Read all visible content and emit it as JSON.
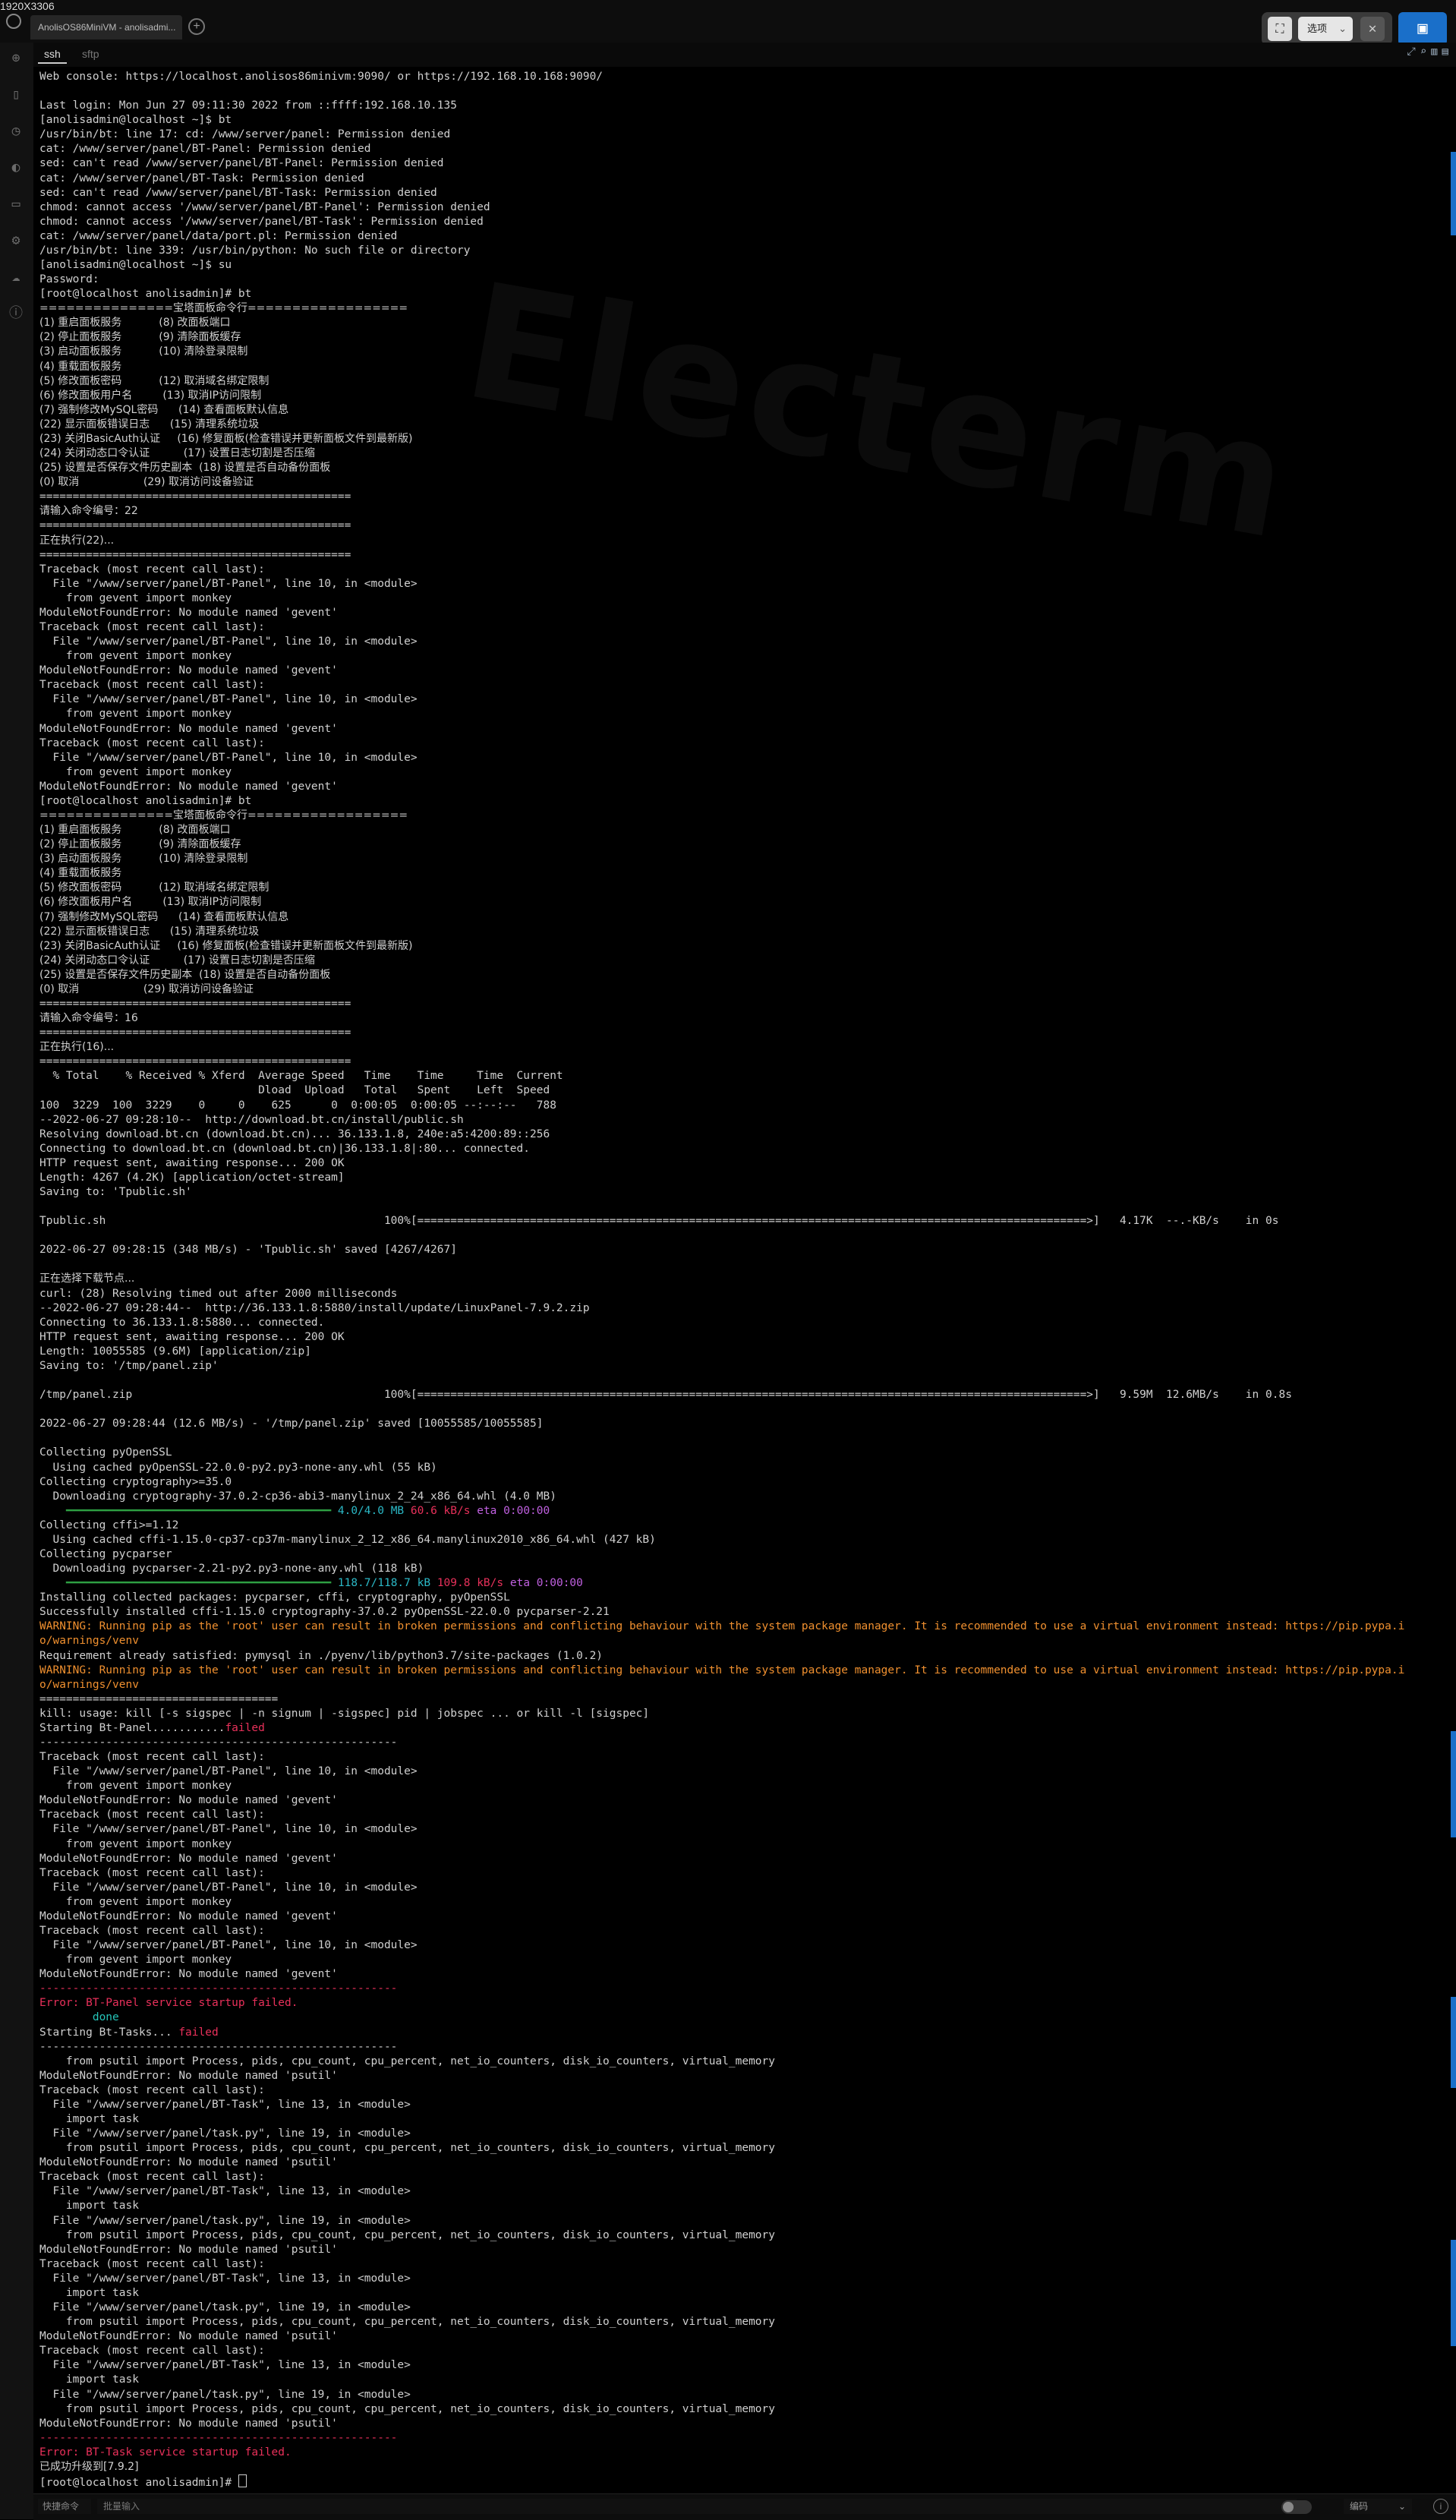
{
  "window": {
    "dimension_label": "1920X3306",
    "tab_title": "AnolisOS86MiniVM - anolisadmi...",
    "tab_add": "+"
  },
  "toolbar": {
    "options_label": "选项",
    "options_chevron": "⌄",
    "screenshot_icon": "crop-frame-icon",
    "close_icon": "close-icon",
    "capture_icon": "capture-icon"
  },
  "session_tabs": [
    "ssh",
    "sftp"
  ],
  "sidebar_icons": [
    "add-icon",
    "bookmark-icon",
    "history-icon",
    "theme-icon",
    "image-icon",
    "settings-icon",
    "cloud-icon",
    "info-icon"
  ],
  "terminal": {
    "lines": [
      {
        "t": "Web console: https://localhost.anolisos86minivm:9090/ or https://192.168.10.168:9090/"
      },
      {
        "t": ""
      },
      {
        "t": "Last login: Mon Jun 27 09:11:30 2022 from ::ffff:192.168.10.135"
      },
      {
        "t": "[anolisadmin@localhost ~]$ bt"
      },
      {
        "t": "/usr/bin/bt: line 17: cd: /www/server/panel: Permission denied"
      },
      {
        "t": "cat: /www/server/panel/BT-Panel: Permission denied"
      },
      {
        "t": "sed: can't read /www/server/panel/BT-Panel: Permission denied"
      },
      {
        "t": "cat: /www/server/panel/BT-Task: Permission denied"
      },
      {
        "t": "sed: can't read /www/server/panel/BT-Task: Permission denied"
      },
      {
        "t": "chmod: cannot access '/www/server/panel/BT-Panel': Permission denied"
      },
      {
        "t": "chmod: cannot access '/www/server/panel/BT-Task': Permission denied"
      },
      {
        "t": "cat: /www/server/panel/data/port.pl: Permission denied"
      },
      {
        "t": "/usr/bin/bt: line 339: /usr/bin/python: No such file or directory"
      },
      {
        "t": "[anolisadmin@localhost ~]$ su"
      },
      {
        "t": "Password:"
      },
      {
        "t": "[root@localhost anolisadmin]# bt"
      },
      {
        "t": "===============宝塔面板命令行==================",
        "c": "cn"
      },
      {
        "t": "(1) 重启面板服务           (8) 改面板端口",
        "c": "cn"
      },
      {
        "t": "(2) 停止面板服务           (9) 清除面板缓存",
        "c": "cn"
      },
      {
        "t": "(3) 启动面板服务           (10) 清除登录限制",
        "c": "cn"
      },
      {
        "t": "(4) 重载面板服务",
        "c": "cn"
      },
      {
        "t": "(5) 修改面板密码           (12) 取消域名绑定限制",
        "c": "cn"
      },
      {
        "t": "(6) 修改面板用户名         (13) 取消IP访问限制",
        "c": "cn"
      },
      {
        "t": "(7) 强制修改MySQL密码      (14) 查看面板默认信息",
        "c": "cn"
      },
      {
        "t": "(22) 显示面板错误日志      (15) 清理系统垃圾",
        "c": "cn"
      },
      {
        "t": "(23) 关闭BasicAuth认证     (16) 修复面板(检查错误并更新面板文件到最新版)",
        "c": "cn"
      },
      {
        "t": "(24) 关闭动态口令认证          (17) 设置日志切割是否压缩",
        "c": "cn"
      },
      {
        "t": "(25) 设置是否保存文件历史副本  (18) 设置是否自动备份面板",
        "c": "cn"
      },
      {
        "t": "(0) 取消                   (29) 取消访问设备验证",
        "c": "cn"
      },
      {
        "t": "==============================================="
      },
      {
        "t": "请输入命令编号：22",
        "c": "cn"
      },
      {
        "t": "==============================================="
      },
      {
        "t": "正在执行(22)...",
        "c": "cn"
      },
      {
        "t": "==============================================="
      },
      {
        "t": "Traceback (most recent call last):"
      },
      {
        "t": "  File \"/www/server/panel/BT-Panel\", line 10, in <module>"
      },
      {
        "t": "    from gevent import monkey"
      },
      {
        "t": "ModuleNotFoundError: No module named 'gevent'"
      },
      {
        "t": "Traceback (most recent call last):"
      },
      {
        "t": "  File \"/www/server/panel/BT-Panel\", line 10, in <module>"
      },
      {
        "t": "    from gevent import monkey"
      },
      {
        "t": "ModuleNotFoundError: No module named 'gevent'"
      },
      {
        "t": "Traceback (most recent call last):"
      },
      {
        "t": "  File \"/www/server/panel/BT-Panel\", line 10, in <module>"
      },
      {
        "t": "    from gevent import monkey"
      },
      {
        "t": "ModuleNotFoundError: No module named 'gevent'"
      },
      {
        "t": "Traceback (most recent call last):"
      },
      {
        "t": "  File \"/www/server/panel/BT-Panel\", line 10, in <module>"
      },
      {
        "t": "    from gevent import monkey"
      },
      {
        "t": "ModuleNotFoundError: No module named 'gevent'"
      },
      {
        "t": "[root@localhost anolisadmin]# bt"
      },
      {
        "t": "===============宝塔面板命令行==================",
        "c": "cn"
      },
      {
        "t": "(1) 重启面板服务           (8) 改面板端口",
        "c": "cn"
      },
      {
        "t": "(2) 停止面板服务           (9) 清除面板缓存",
        "c": "cn"
      },
      {
        "t": "(3) 启动面板服务           (10) 清除登录限制",
        "c": "cn"
      },
      {
        "t": "(4) 重载面板服务",
        "c": "cn"
      },
      {
        "t": "(5) 修改面板密码           (12) 取消域名绑定限制",
        "c": "cn"
      },
      {
        "t": "(6) 修改面板用户名         (13) 取消IP访问限制",
        "c": "cn"
      },
      {
        "t": "(7) 强制修改MySQL密码      (14) 查看面板默认信息",
        "c": "cn"
      },
      {
        "t": "(22) 显示面板错误日志      (15) 清理系统垃圾",
        "c": "cn"
      },
      {
        "t": "(23) 关闭BasicAuth认证     (16) 修复面板(检查错误并更新面板文件到最新版)",
        "c": "cn"
      },
      {
        "t": "(24) 关闭动态口令认证          (17) 设置日志切割是否压缩",
        "c": "cn"
      },
      {
        "t": "(25) 设置是否保存文件历史副本  (18) 设置是否自动备份面板",
        "c": "cn"
      },
      {
        "t": "(0) 取消                   (29) 取消访问设备验证",
        "c": "cn"
      },
      {
        "t": "==============================================="
      },
      {
        "t": "请输入命令编号：16",
        "c": "cn"
      },
      {
        "t": "==============================================="
      },
      {
        "t": "正在执行(16)...",
        "c": "cn"
      },
      {
        "t": "==============================================="
      },
      {
        "t": "  % Total    % Received % Xferd  Average Speed   Time    Time     Time  Current"
      },
      {
        "t": "                                 Dload  Upload   Total   Spent    Left  Speed"
      },
      {
        "t": "100  3229  100  3229    0     0    625      0  0:00:05  0:00:05 --:--:--   788"
      },
      {
        "t": "--2022-06-27 09:28:10--  http://download.bt.cn/install/public.sh"
      },
      {
        "t": "Resolving download.bt.cn (download.bt.cn)... 36.133.1.8, 240e:a5:4200:89::256"
      },
      {
        "t": "Connecting to download.bt.cn (download.bt.cn)|36.133.1.8|:80... connected."
      },
      {
        "t": "HTTP request sent, awaiting response... 200 OK"
      },
      {
        "t": "Length: 4267 (4.2K) [application/octet-stream]"
      },
      {
        "t": "Saving to: 'Tpublic.sh'"
      },
      {
        "t": ""
      },
      {
        "t": "Tpublic.sh                                          100%[=====================================================================================================>]   4.17K  --.-KB/s    in 0s"
      },
      {
        "t": ""
      },
      {
        "t": "2022-06-27 09:28:15 (348 MB/s) - 'Tpublic.sh' saved [4267/4267]"
      },
      {
        "t": ""
      },
      {
        "t": "正在选择下载节点...",
        "c": "cn"
      },
      {
        "t": "curl: (28) Resolving timed out after 2000 milliseconds"
      },
      {
        "t": "--2022-06-27 09:28:44--  http://36.133.1.8:5880/install/update/LinuxPanel-7.9.2.zip"
      },
      {
        "t": "Connecting to 36.133.1.8:5880... connected."
      },
      {
        "t": "HTTP request sent, awaiting response... 200 OK"
      },
      {
        "t": "Length: 10055585 (9.6M) [application/zip]"
      },
      {
        "t": "Saving to: '/tmp/panel.zip'"
      },
      {
        "t": ""
      },
      {
        "t": "/tmp/panel.zip                                      100%[=====================================================================================================>]   9.59M  12.6MB/s    in 0.8s"
      },
      {
        "t": ""
      },
      {
        "t": "2022-06-27 09:28:44 (12.6 MB/s) - '/tmp/panel.zip' saved [10055585/10055585]"
      },
      {
        "t": ""
      },
      {
        "t": "Collecting pyOpenSSL"
      },
      {
        "t": "  Using cached pyOpenSSL-22.0.0-py2.py3-none-any.whl (55 kB)"
      },
      {
        "t": "Collecting cryptography>=35.0"
      },
      {
        "t": "  Downloading cryptography-37.0.2-cp36-abi3-manylinux_2_24_x86_64.whl (4.0 MB)"
      },
      {
        "t": "",
        "progress": {
          "bar": "━━━━━━━━━━━━━━━━━━━━━━━━━━━━━━━━━━━━━━━━",
          "size": "4.0/4.0 MB",
          "rate": "60.6 kB/s",
          "eta": "eta 0:00:00"
        }
      },
      {
        "t": "Collecting cffi>=1.12"
      },
      {
        "t": "  Using cached cffi-1.15.0-cp37-cp37m-manylinux_2_12_x86_64.manylinux2010_x86_64.whl (427 kB)"
      },
      {
        "t": "Collecting pycparser"
      },
      {
        "t": "  Downloading pycparser-2.21-py2.py3-none-any.whl (118 kB)"
      },
      {
        "t": "",
        "progress": {
          "bar": "━━━━━━━━━━━━━━━━━━━━━━━━━━━━━━━━━━━━━━━━",
          "size": "118.7/118.7 kB",
          "rate": "109.8 kB/s",
          "eta": "eta 0:00:00"
        }
      },
      {
        "t": "Installing collected packages: pycparser, cffi, cryptography, pyOpenSSL"
      },
      {
        "t": "Successfully installed cffi-1.15.0 cryptography-37.0.2 pyOpenSSL-22.0.0 pycparser-2.21"
      },
      {
        "t": "WARNING: Running pip as the 'root' user can result in broken permissions and conflicting behaviour with the system package manager. It is recommended to use a virtual environment instead: https://pip.pypa.i",
        "c": "orange"
      },
      {
        "t": "o/warnings/venv",
        "c": "orange"
      },
      {
        "t": "Requirement already satisfied: pymysql in ./pyenv/lib/python3.7/site-packages (1.0.2)"
      },
      {
        "t": "WARNING: Running pip as the 'root' user can result in broken permissions and conflicting behaviour with the system package manager. It is recommended to use a virtual environment instead: https://pip.pypa.i",
        "c": "orange"
      },
      {
        "t": "o/warnings/venv",
        "c": "orange"
      },
      {
        "t": "===================================="
      },
      {
        "t": "kill: usage: kill [-s sigspec | -n signum | -sigspec] pid | jobspec ... or kill -l [sigspec]"
      },
      {
        "t": "Starting Bt-Panel...........",
        "fail": "failed"
      },
      {
        "t": "------------------------------------------------------"
      },
      {
        "t": "Traceback (most recent call last):"
      },
      {
        "t": "  File \"/www/server/panel/BT-Panel\", line 10, in <module>"
      },
      {
        "t": "    from gevent import monkey"
      },
      {
        "t": "ModuleNotFoundError: No module named 'gevent'"
      },
      {
        "t": "Traceback (most recent call last):"
      },
      {
        "t": "  File \"/www/server/panel/BT-Panel\", line 10, in <module>"
      },
      {
        "t": "    from gevent import monkey"
      },
      {
        "t": "ModuleNotFoundError: No module named 'gevent'"
      },
      {
        "t": "Traceback (most recent call last):"
      },
      {
        "t": "  File \"/www/server/panel/BT-Panel\", line 10, in <module>"
      },
      {
        "t": "    from gevent import monkey"
      },
      {
        "t": "ModuleNotFoundError: No module named 'gevent'"
      },
      {
        "t": "Traceback (most recent call last):"
      },
      {
        "t": "  File \"/www/server/panel/BT-Panel\", line 10, in <module>"
      },
      {
        "t": "    from gevent import monkey"
      },
      {
        "t": "ModuleNotFoundError: No module named 'gevent'"
      },
      {
        "t": "------------------------------------------------------",
        "c": "red"
      },
      {
        "t": "Error: BT-Panel service startup failed.",
        "c": "red"
      },
      {
        "t": "        done",
        "c": "teal"
      },
      {
        "t": "Starting Bt-Tasks... ",
        "fail": "failed"
      },
      {
        "t": "------------------------------------------------------"
      },
      {
        "t": "    from psutil import Process, pids, cpu_count, cpu_percent, net_io_counters, disk_io_counters, virtual_memory"
      },
      {
        "t": "ModuleNotFoundError: No module named 'psutil'"
      },
      {
        "t": "Traceback (most recent call last):"
      },
      {
        "t": "  File \"/www/server/panel/BT-Task\", line 13, in <module>"
      },
      {
        "t": "    import task"
      },
      {
        "t": "  File \"/www/server/panel/task.py\", line 19, in <module>"
      },
      {
        "t": "    from psutil import Process, pids, cpu_count, cpu_percent, net_io_counters, disk_io_counters, virtual_memory"
      },
      {
        "t": "ModuleNotFoundError: No module named 'psutil'"
      },
      {
        "t": "Traceback (most recent call last):"
      },
      {
        "t": "  File \"/www/server/panel/BT-Task\", line 13, in <module>"
      },
      {
        "t": "    import task"
      },
      {
        "t": "  File \"/www/server/panel/task.py\", line 19, in <module>"
      },
      {
        "t": "    from psutil import Process, pids, cpu_count, cpu_percent, net_io_counters, disk_io_counters, virtual_memory"
      },
      {
        "t": "ModuleNotFoundError: No module named 'psutil'"
      },
      {
        "t": "Traceback (most recent call last):"
      },
      {
        "t": "  File \"/www/server/panel/BT-Task\", line 13, in <module>"
      },
      {
        "t": "    import task"
      },
      {
        "t": "  File \"/www/server/panel/task.py\", line 19, in <module>"
      },
      {
        "t": "    from psutil import Process, pids, cpu_count, cpu_percent, net_io_counters, disk_io_counters, virtual_memory"
      },
      {
        "t": "ModuleNotFoundError: No module named 'psutil'"
      },
      {
        "t": "Traceback (most recent call last):"
      },
      {
        "t": "  File \"/www/server/panel/BT-Task\", line 13, in <module>"
      },
      {
        "t": "    import task"
      },
      {
        "t": "  File \"/www/server/panel/task.py\", line 19, in <module>"
      },
      {
        "t": "    from psutil import Process, pids, cpu_count, cpu_percent, net_io_counters, disk_io_counters, virtual_memory"
      },
      {
        "t": "ModuleNotFoundError: No module named 'psutil'"
      },
      {
        "t": "------------------------------------------------------",
        "c": "red"
      },
      {
        "t": "Error: BT-Task service startup failed.",
        "c": "red"
      },
      {
        "t": "已成功升级到[7.9.2]",
        "c": "cn"
      },
      {
        "t": "[root@localhost anolisadmin]# ",
        "cursor": true
      }
    ]
  },
  "watermark": "Electerm",
  "footer": {
    "quick_command": "快捷命令",
    "batch_input_placeholder": "批量输入",
    "encoding": "编码",
    "encoding_chevron": "⌄"
  }
}
